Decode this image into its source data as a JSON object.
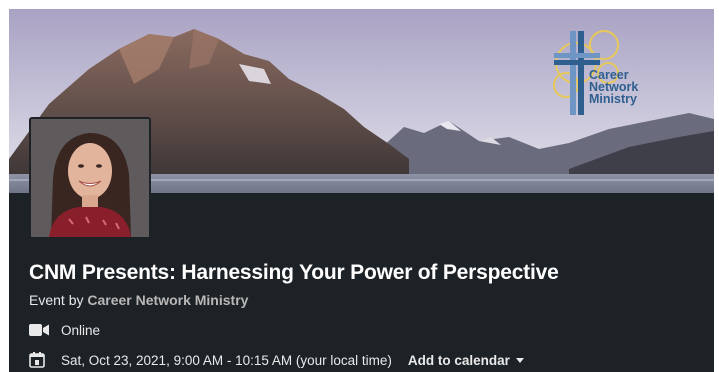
{
  "banner": {
    "logo_lines": [
      "Career",
      "Network",
      "Ministry"
    ],
    "logo_color": "#2f5f8f"
  },
  "event": {
    "title": "CNM Presents: Harnessing Your Power of Perspective",
    "byline_prefix": "Event by",
    "organizer": "Career Network Ministry",
    "location": "Online",
    "date_time": "Sat, Oct 23, 2021, 9:00 AM - 10:15 AM (your local time)",
    "add_to_calendar": "Add to calendar"
  },
  "icons": {
    "location": "video-camera-icon",
    "date": "calendar-icon",
    "dropdown": "caret-down-icon"
  },
  "colors": {
    "card_background": "#1d2226",
    "title_text": "#ffffff",
    "organizer_text": "#b8b8b8"
  }
}
